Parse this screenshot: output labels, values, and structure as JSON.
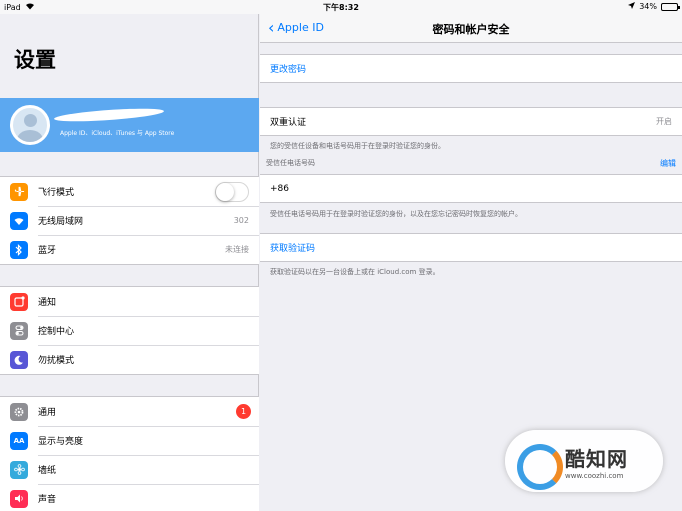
{
  "statusbar": {
    "device": "iPad",
    "time": "下午8:32",
    "battery": "34%",
    "battery_level": 0.34
  },
  "sidebar": {
    "title": "设置",
    "profile_subtitle": "Apple ID、iCloud、iTunes 与 App Store",
    "group1": [
      {
        "label": "飞行模式",
        "icon": "airplane-icon",
        "color": "#ff9500",
        "value": "",
        "toggle": false
      },
      {
        "label": "无线局域网",
        "icon": "wifi-icon",
        "color": "#007aff",
        "value": "302"
      },
      {
        "label": "蓝牙",
        "icon": "bluetooth-icon",
        "color": "#007aff",
        "value": "未连接"
      }
    ],
    "group2": [
      {
        "label": "通知",
        "icon": "notification-icon",
        "color": "#ff3b30"
      },
      {
        "label": "控制中心",
        "icon": "control-center-icon",
        "color": "#8e8e93"
      },
      {
        "label": "勿扰模式",
        "icon": "moon-icon",
        "color": "#5856d6"
      }
    ],
    "group3": [
      {
        "label": "通用",
        "icon": "gear-icon",
        "color": "#8e8e93",
        "badge": "1"
      },
      {
        "label": "显示与亮度",
        "icon": "display-icon",
        "color": "#007aff"
      },
      {
        "label": "墙纸",
        "icon": "wallpaper-icon",
        "color": "#34aadc"
      },
      {
        "label": "声音",
        "icon": "sound-icon",
        "color": "#ff2d55"
      }
    ]
  },
  "detail": {
    "back_label": "Apple ID",
    "title": "密码和帐户安全",
    "change_password": "更改密码",
    "two_factor_label": "双重认证",
    "two_factor_value": "开启",
    "two_factor_note": "您的受信任设备和电话号码用于在登录时验证您的身份。",
    "trusted_header": "受信任电话号码",
    "edit_label": "编辑",
    "phone_number": "+86",
    "phone_note": "受信任电话号码用于在登录时验证您的身份，以及在您忘记密码时恢复您的帐户。",
    "get_code": "获取验证码",
    "get_code_note": "获取验证码以在另一台设备上或在 iCloud.com 登录。"
  },
  "watermark": {
    "name": "酷知网",
    "url": "www.coozhi.com"
  }
}
